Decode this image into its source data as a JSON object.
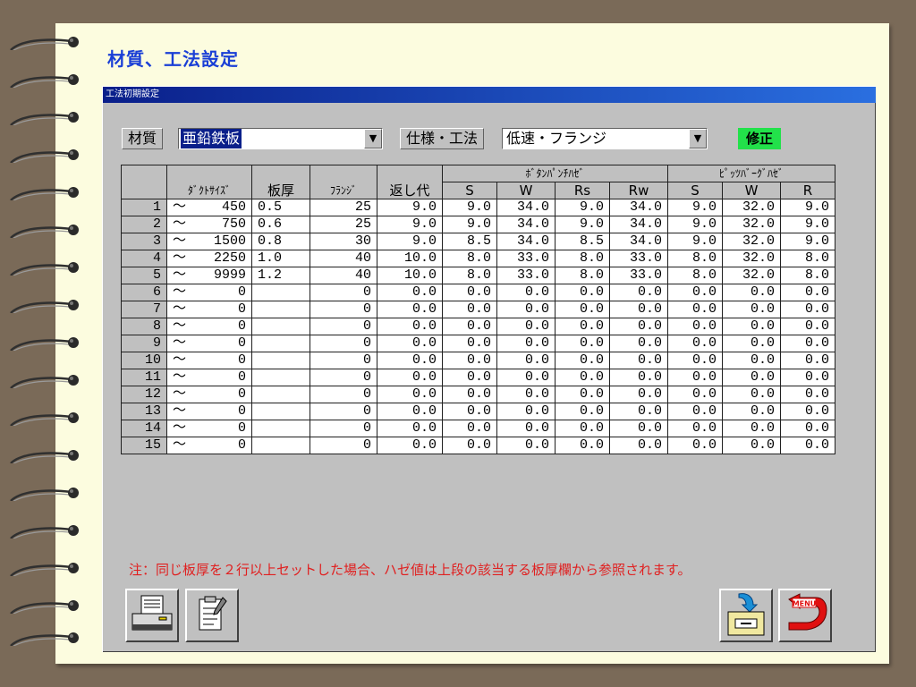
{
  "page": {
    "title": "材質、工法設定"
  },
  "window": {
    "title": "工法初期設定"
  },
  "controls": {
    "material_label": "材質",
    "material_value": "亜鉛鉄板",
    "spec_label": "仕様・工法",
    "spec_value": "低速・フランジ",
    "status": "修正"
  },
  "table": {
    "group_headers": [
      "ﾎﾞﾀﾝﾊﾟﾝﾁﾊｾﾞ",
      "ﾋﾟｯﾂﾊﾞｰｸﾞﾊｾﾞ"
    ],
    "headers": [
      "ﾀﾞｸﾄｻｲｽﾞ",
      "板厚",
      "ﾌﾗﾝｼﾞ",
      "返し代",
      "S",
      "W",
      "Rs",
      "Rw",
      "S",
      "W",
      "R"
    ],
    "rows": [
      [
        "1",
        "～",
        "450",
        "0.5",
        "25",
        "9.0",
        "9.0",
        "34.0",
        "9.0",
        "34.0",
        "9.0",
        "32.0",
        "9.0"
      ],
      [
        "2",
        "～",
        "750",
        "0.6",
        "25",
        "9.0",
        "9.0",
        "34.0",
        "9.0",
        "34.0",
        "9.0",
        "32.0",
        "9.0"
      ],
      [
        "3",
        "～",
        "1500",
        "0.8",
        "30",
        "9.0",
        "8.5",
        "34.0",
        "8.5",
        "34.0",
        "9.0",
        "32.0",
        "9.0"
      ],
      [
        "4",
        "～",
        "2250",
        "1.0",
        "40",
        "10.0",
        "8.0",
        "33.0",
        "8.0",
        "33.0",
        "8.0",
        "32.0",
        "8.0"
      ],
      [
        "5",
        "～",
        "9999",
        "1.2",
        "40",
        "10.0",
        "8.0",
        "33.0",
        "8.0",
        "33.0",
        "8.0",
        "32.0",
        "8.0"
      ],
      [
        "6",
        "～",
        "0",
        "",
        "0",
        "0.0",
        "0.0",
        "0.0",
        "0.0",
        "0.0",
        "0.0",
        "0.0",
        "0.0"
      ],
      [
        "7",
        "～",
        "0",
        "",
        "0",
        "0.0",
        "0.0",
        "0.0",
        "0.0",
        "0.0",
        "0.0",
        "0.0",
        "0.0"
      ],
      [
        "8",
        "～",
        "0",
        "",
        "0",
        "0.0",
        "0.0",
        "0.0",
        "0.0",
        "0.0",
        "0.0",
        "0.0",
        "0.0"
      ],
      [
        "9",
        "～",
        "0",
        "",
        "0",
        "0.0",
        "0.0",
        "0.0",
        "0.0",
        "0.0",
        "0.0",
        "0.0",
        "0.0"
      ],
      [
        "10",
        "～",
        "0",
        "",
        "0",
        "0.0",
        "0.0",
        "0.0",
        "0.0",
        "0.0",
        "0.0",
        "0.0",
        "0.0"
      ],
      [
        "11",
        "～",
        "0",
        "",
        "0",
        "0.0",
        "0.0",
        "0.0",
        "0.0",
        "0.0",
        "0.0",
        "0.0",
        "0.0"
      ],
      [
        "12",
        "～",
        "0",
        "",
        "0",
        "0.0",
        "0.0",
        "0.0",
        "0.0",
        "0.0",
        "0.0",
        "0.0",
        "0.0"
      ],
      [
        "13",
        "～",
        "0",
        "",
        "0",
        "0.0",
        "0.0",
        "0.0",
        "0.0",
        "0.0",
        "0.0",
        "0.0",
        "0.0"
      ],
      [
        "14",
        "～",
        "0",
        "",
        "0",
        "0.0",
        "0.0",
        "0.0",
        "0.0",
        "0.0",
        "0.0",
        "0.0",
        "0.0"
      ],
      [
        "15",
        "～",
        "0",
        "",
        "0",
        "0.0",
        "0.0",
        "0.0",
        "0.0",
        "0.0",
        "0.0",
        "0.0",
        "0.0"
      ]
    ]
  },
  "note": "注：同じ板厚を２行以上セットした場合、ハゼ値は上段の該当する板厚欄から参照されます。",
  "buttons": {
    "print_icon": "printer-icon",
    "form_icon": "clipboard-icon",
    "save_icon": "file-cabinet-icon",
    "menu_icon": "menu-return-icon",
    "menu_text": "MENU"
  },
  "colors": {
    "title": "#1a3fd6",
    "status_bg": "#22e14a",
    "note": "#e02020"
  }
}
